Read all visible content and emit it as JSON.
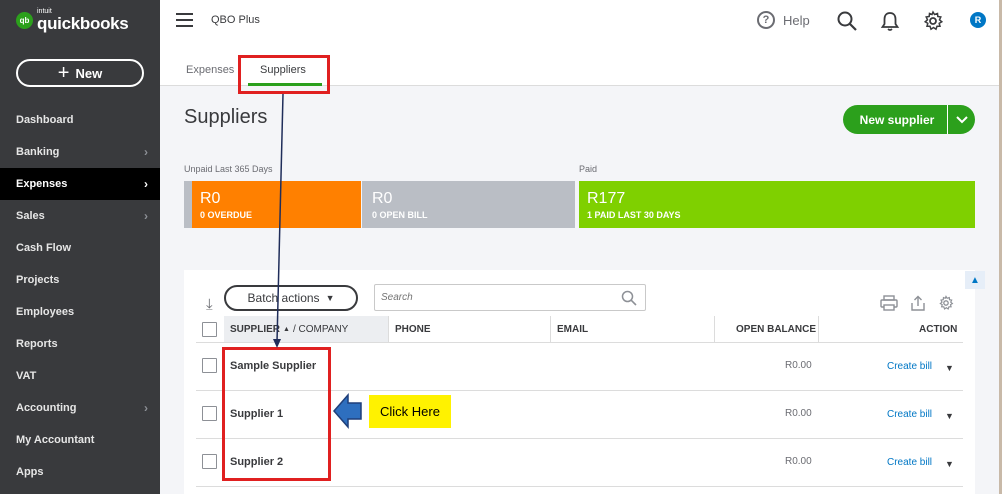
{
  "app": {
    "logo_small": "intuit",
    "logo_big": "quickbooks",
    "logo_mark": "qb",
    "company": "QBO Plus"
  },
  "sidebar": {
    "new_label": "New",
    "items": [
      {
        "label": "Dashboard",
        "chevron": false
      },
      {
        "label": "Banking",
        "chevron": true
      },
      {
        "label": "Expenses",
        "chevron": true,
        "active": true
      },
      {
        "label": "Sales",
        "chevron": true
      },
      {
        "label": "Cash Flow",
        "chevron": false
      },
      {
        "label": "Projects",
        "chevron": false
      },
      {
        "label": "Employees",
        "chevron": false
      },
      {
        "label": "Reports",
        "chevron": false
      },
      {
        "label": "VAT",
        "chevron": false
      },
      {
        "label": "Accounting",
        "chevron": true
      },
      {
        "label": "My Accountant",
        "chevron": false
      },
      {
        "label": "Apps",
        "chevron": false
      }
    ]
  },
  "topbar": {
    "help_label": "Help",
    "avatar_initial": "R"
  },
  "tabs": [
    {
      "label": "Expenses"
    },
    {
      "label": "Suppliers",
      "active": true
    }
  ],
  "page": {
    "title": "Suppliers",
    "new_supplier_label": "New supplier"
  },
  "money_bar": {
    "unpaid_label": "Unpaid Last 365 Days",
    "paid_label": "Paid",
    "segments": [
      {
        "amount": "R0",
        "sub": "0 OVERDUE",
        "color": "#ff8000"
      },
      {
        "amount": "R0",
        "sub": "0 OPEN BILL",
        "color": "#babec5"
      },
      {
        "amount": "R177",
        "sub": "1 PAID LAST 30 DAYS",
        "color": "#7fd000"
      }
    ]
  },
  "table": {
    "batch_actions_label": "Batch actions",
    "search_placeholder": "Search",
    "columns": {
      "supplier": "SUPPLIER",
      "company": "/ COMPANY",
      "phone": "PHONE",
      "email": "EMAIL",
      "open_balance": "OPEN BALANCE",
      "action": "ACTION"
    },
    "rows": [
      {
        "name": "Sample Supplier",
        "balance": "R0.00",
        "action": "Create bill"
      },
      {
        "name": "Supplier 1",
        "balance": "R0.00",
        "action": "Create bill"
      },
      {
        "name": "Supplier 2",
        "balance": "R0.00",
        "action": "Create bill"
      }
    ]
  },
  "annotation": {
    "note": "Click Here",
    "red": "#e02020",
    "arrow_blue": "#1f4e9a"
  },
  "colors": {
    "brand_green": "#2ca01c",
    "link_blue": "#0077c5",
    "sidebar_bg": "#393a3d"
  }
}
